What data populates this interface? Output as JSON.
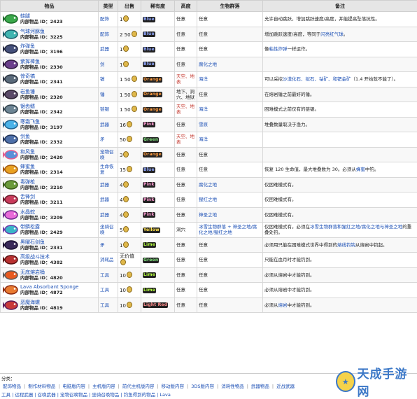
{
  "headers": {
    "item": "物品",
    "type": "类型",
    "sell": "出售",
    "rarity": "稀有度",
    "depth": "高度",
    "biome": "生物群落",
    "note": "备注"
  },
  "rows": [
    {
      "name": "蛙腿",
      "iid_label": "内部物品 ID：",
      "iid": "2423",
      "type": "配饰",
      "sell": "1",
      "rarity": "Blue",
      "rarity_color": "#8fa6ff",
      "depth": "任意",
      "biome": "任意",
      "note": "允许自动跳跃，增加跳跃速度/高度，并能提高坠落抗性。",
      "note_link": "",
      "note2": "",
      "icon": "frog-leg-icon",
      "c1": "#3aa84a",
      "c2": "#1d6b2a"
    },
    {
      "name": "气球河豚鱼",
      "iid_label": "内部物品 ID：",
      "iid": "3225",
      "type": "配饰",
      "sell": "2 50",
      "rarity": "Blue",
      "rarity_color": "#8fa6ff",
      "depth": "任意",
      "biome": "任意",
      "note": "增加跳跃速度/高度，等同于",
      "note_link": "闪亮红气球",
      "note2": "。",
      "icon": "balloon-fish-icon",
      "c1": "#3fb5b0",
      "c2": "#1d5f6b"
    },
    {
      "name": "炸弹鱼",
      "iid_label": "内部物品 ID：",
      "iid": "3196",
      "type": "武器",
      "sell": "1",
      "rarity": "Blue",
      "rarity_color": "#8fa6ff",
      "depth": "任意",
      "biome": "任意",
      "note": "像",
      "note_link": "粘性炸弹",
      "note2": "一样运作。",
      "icon": "bomb-fish-icon",
      "c1": "#45507a",
      "c2": "#20253d"
    },
    {
      "name": "紫挥棒鱼",
      "iid_label": "内部物品 ID：",
      "iid": "2330",
      "type": "剑",
      "sell": "1",
      "rarity": "Blue",
      "rarity_color": "#8fa6ff",
      "depth": "任意",
      "biome": "腐化之地",
      "note": "",
      "note_link": "",
      "note2": "",
      "icon": "purple-clubberfish-icon",
      "c1": "#6b3f8c",
      "c2": "#2e1a3f"
    },
    {
      "name": "惊奇镐",
      "iid_label": "内部物品 ID：",
      "iid": "2341",
      "type": "镐",
      "sell": "1 50",
      "rarity": "Orange",
      "rarity_color": "#ff9a3c",
      "depth": "天空、地表",
      "biome": "海洋",
      "note": "可以采挖",
      "note_link": "沙漠化石、狱石、钴矿、和钯金矿",
      "note2": "（1.4 开始就不能了）。",
      "icon": "reaver-shark-icon",
      "c1": "#5a6a7a",
      "c2": "#2b3340"
    },
    {
      "name": "岩鱼锤",
      "iid_label": "内部物品 ID：",
      "iid": "2320",
      "type": "锤",
      "sell": "1 50",
      "rarity": "Orange",
      "rarity_color": "#ff9a3c",
      "depth": "地下、洞穴、地狱",
      "biome": "任意",
      "note": "在熔岩锤之前最好的锤。",
      "note_link": "",
      "note2": "",
      "icon": "rockfish-icon",
      "c1": "#5b4a68",
      "c2": "#2a2030"
    },
    {
      "name": "锯齿鳍",
      "iid_label": "内部物品 ID：",
      "iid": "2342",
      "type": "链锯",
      "sell": "1 50",
      "rarity": "Orange",
      "rarity_color": "#ff9a3c",
      "depth": "天空、地表",
      "biome": "海洋",
      "note": "困难模式之前仅有的链锯。",
      "note_link": "",
      "note2": "",
      "icon": "sawtooth-shark-icon",
      "c1": "#6d8594",
      "c2": "#33434e"
    },
    {
      "name": "寒霜飞鱼",
      "iid_label": "内部物品 ID：",
      "iid": "3197",
      "type": "武器",
      "sell": "16",
      "rarity": "Pink",
      "rarity_color": "#ff9ad2",
      "depth": "任意",
      "biome": "雪原",
      "note": "堆叠数量取决于渔力。",
      "note_link": "",
      "note2": "",
      "icon": "frost-daggerfish-icon",
      "c1": "#4ab2e8",
      "c2": "#1f5f8c"
    },
    {
      "name": "剑鱼",
      "iid_label": "内部物品 ID：",
      "iid": "2332",
      "type": "矛",
      "sell": "50",
      "rarity": "Green",
      "rarity_color": "#7de07a",
      "depth": "天空、地表",
      "biome": "海洋",
      "note": "",
      "note_link": "",
      "note2": "",
      "icon": "swordfish-icon",
      "c1": "#4d6fa8",
      "c2": "#21345a"
    },
    {
      "name": "和风鱼",
      "iid_label": "内部物品 ID：",
      "iid": "2420",
      "type": "宠物召唤",
      "sell": "3",
      "rarity": "Orange",
      "rarity_color": "#ff9a3c",
      "depth": "任意",
      "biome": "任意",
      "note": "",
      "note_link": "",
      "note2": "",
      "icon": "zephyr-fish-icon",
      "c1": "#5a8fd8",
      "c2": "#e85a8c"
    },
    {
      "name": "蜂蜜鱼",
      "iid_label": "内部物品 ID：",
      "iid": "2314",
      "type": "生命恢复",
      "sell": "15",
      "rarity": "Blue",
      "rarity_color": "#8fa6ff",
      "depth": "任意",
      "biome": "任意",
      "note": "恢复 120 生命值，最大堆叠数为 30。必须从",
      "note_link": "蜂蜜",
      "note2": "中钓。",
      "icon": "honeyfin-icon",
      "c1": "#e8a020",
      "c2": "#a35a10"
    },
    {
      "name": "毒弹枪",
      "iid_label": "内部物品 ID：",
      "iid": "3210",
      "type": "武器",
      "sell": "4",
      "rarity": "Pink",
      "rarity_color": "#ff9ad2",
      "depth": "任意",
      "biome": "腐化之地",
      "note": "仅困难模式有。",
      "note_link": "",
      "note2": "",
      "icon": "toxikarp-icon",
      "c1": "#6a9a3a",
      "c2": "#3a5a1a"
    },
    {
      "name": "舌锋剑",
      "iid_label": "内部物品 ID：",
      "iid": "3211",
      "type": "武器",
      "sell": "4",
      "rarity": "Pink",
      "rarity_color": "#ff9ad2",
      "depth": "任意",
      "biome": "猩红之地",
      "note": "仅困难模式有。",
      "note_link": "",
      "note2": "",
      "icon": "bladetongue-icon",
      "c1": "#c83a5a",
      "c2": "#6a1a2a"
    },
    {
      "name": "水晶蛇",
      "iid_label": "内部物品 ID：",
      "iid": "3209",
      "type": "武器",
      "sell": "4",
      "rarity": "Pink",
      "rarity_color": "#ff9ad2",
      "depth": "任意",
      "biome": "神圣之地",
      "note": "仅困难模式有。",
      "note_link": "",
      "note2": "",
      "icon": "crystal-serpent-icon",
      "c1": "#e86ad8",
      "c2": "#6a2a8c"
    },
    {
      "name": "带鳞松露",
      "iid_label": "内部物品 ID：",
      "iid": "2429",
      "type": "坐骑召唤",
      "sell": "5",
      "rarity": "Yellow",
      "rarity_color": "#ffe14a",
      "depth": "洞穴",
      "biome": "冰雪生物群落 + 神圣之地/腐化之地/猩红之地",
      "note": "仅困难模式有。必须在",
      "note_link": "冰雪生物群落和猩红之地/腐化之地与神圣之地",
      "note2": "的重叠处钓。",
      "icon": "scaly-truffle-icon",
      "c1": "#3ab5c8",
      "c2": "#6a3aa8"
    },
    {
      "name": "黑曜石剑鱼",
      "iid_label": "内部物品 ID：",
      "iid": "2331",
      "type": "矛",
      "sell": "1",
      "rarity": "Lime",
      "rarity_color": "#b4ff3c",
      "depth": "任意",
      "biome": "任意",
      "note": "必须用只能在困难模式世界中得到的",
      "note_link": "熔线钓钩",
      "note2": "从熔岩中钓起。",
      "icon": "obsidian-swordfish-icon",
      "c1": "#3a2a5a",
      "c2": "#1a1030"
    },
    {
      "name": "高级战斗技术",
      "iid_label": "内部物品 ID：",
      "iid": "4382",
      "type": "消耗品",
      "sell": "无价值",
      "rarity": "Green",
      "rarity_color": "#7de07a",
      "depth": "任意",
      "biome": "任意",
      "note": "只能在血月时才能钓到。",
      "note_link": "",
      "note2": "",
      "icon": "combat-book-icon",
      "c1": "#b83030",
      "c2": "#5a1010"
    },
    {
      "name": "无底熔岩桶",
      "iid_label": "内部物品 ID：",
      "iid": "4820",
      "type": "工具",
      "sell": "10",
      "rarity": "Lime",
      "rarity_color": "#b4ff3c",
      "depth": "任意",
      "biome": "任意",
      "note": "必须从熔岩中才能钓到。",
      "note_link": "",
      "note2": "",
      "icon": "lava-bucket-icon",
      "c1": "#e85a20",
      "c2": "#5a5a5a"
    },
    {
      "name": "Lava Absorbant Sponge",
      "iid_label": "内部物品 ID：",
      "iid": "4872",
      "type": "工具",
      "sell": "10",
      "rarity": "Lime",
      "rarity_color": "#b4ff3c",
      "depth": "任意",
      "biome": "任意",
      "note": "必须从熔岩中才能钓到。",
      "note_link": "",
      "note2": "",
      "icon": "lava-sponge-icon",
      "c1": "#e87a30",
      "c2": "#8c2a10"
    },
    {
      "name": "恶魔海螺",
      "iid_label": "内部物品 ID：",
      "iid": "4819",
      "type": "工具",
      "sell": "10",
      "rarity": "Light Red",
      "rarity_color": "#ff8a8a",
      "depth": "任意",
      "biome": "任意",
      "note": "必须从",
      "note_link": "熔岩",
      "note2": "中才能钓到。",
      "icon": "demon-conch-icon",
      "c1": "#c83a3a",
      "c2": "#5a1a5a"
    }
  ],
  "footer": {
    "label": "分类：",
    "categories": [
      "配饰物品",
      "制作材料物品",
      "电脑版内容",
      "主机版内容",
      "前代主机版内容",
      "移动版内容",
      "3DS版内容",
      "消耗性物品",
      "武器物品",
      "近战武器"
    ],
    "categories2": "工具 | 远程武器 | 召唤武器 | 宠物召唤物品 | 坐骑召唤物品 | 钓鱼得到的物品 | Lava"
  },
  "watermark": "天成手游网"
}
